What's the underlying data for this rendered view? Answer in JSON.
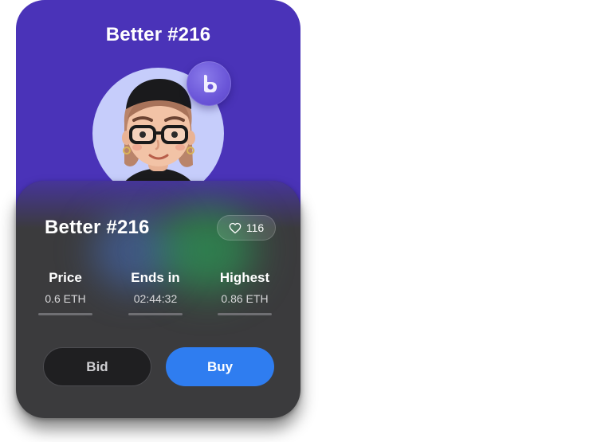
{
  "nft": {
    "header_title": "Better #216",
    "title": "Better #216",
    "likes": "116"
  },
  "stats": [
    {
      "label": "Price",
      "value": "0.6 ETH"
    },
    {
      "label": "Ends in",
      "value": "02:44:32"
    },
    {
      "label": "Highest",
      "value": "0.86 ETH"
    }
  ],
  "actions": {
    "bid_label": "Bid",
    "buy_label": "Buy"
  },
  "icons": {
    "badge": "thumbs-up-b-icon",
    "likes": "heart-icon"
  },
  "colors": {
    "card_top": "#4a33b8",
    "card_bottom": "#3b3b3d",
    "avatar_bg": "#c6cdfb",
    "buy_button": "#2f7df0",
    "bid_button": "#1f1f21"
  }
}
